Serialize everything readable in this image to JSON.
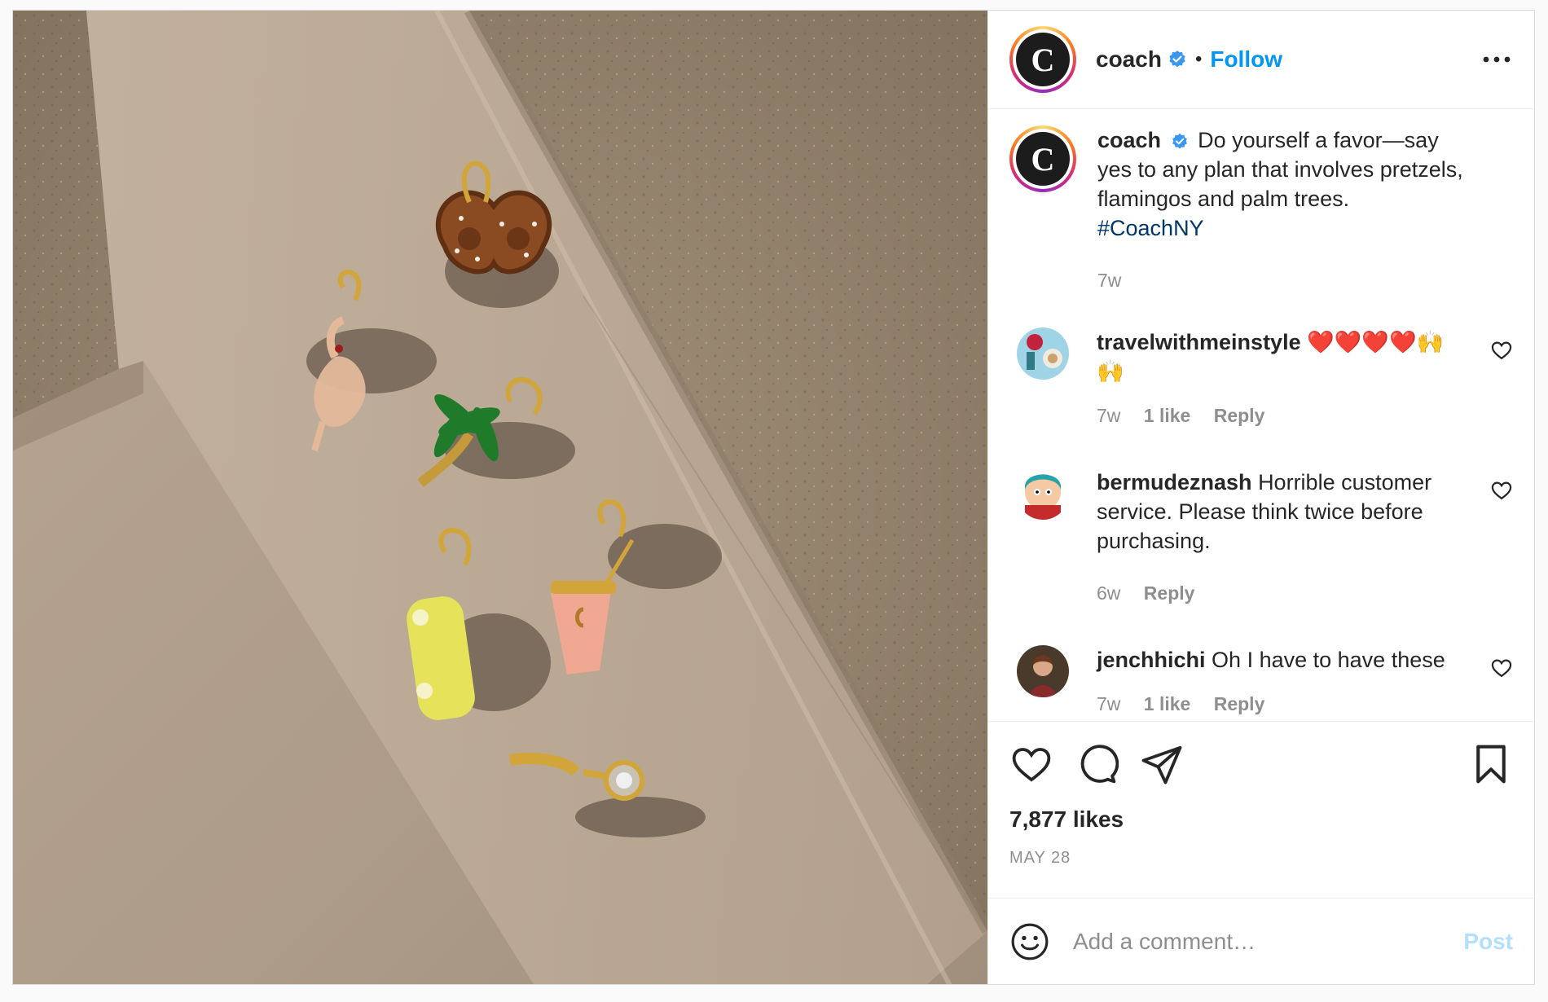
{
  "header": {
    "username": "coach",
    "separator": "•",
    "follow_label": "Follow"
  },
  "caption": {
    "username": "coach",
    "text": "Do yourself a favor—say yes to any plan that involves pretzels, flamingos and palm trees.",
    "hashtag": "#CoachNY",
    "time": "7w"
  },
  "comments": [
    {
      "username": "travelwithmeinstyle",
      "text": "❤️❤️❤️❤️🙌🙌",
      "time": "7w",
      "likes": "1 like",
      "reply_label": "Reply"
    },
    {
      "username": "bermudeznash",
      "text": "Horrible customer service. Please think twice before purchasing.",
      "time": "6w",
      "reply_label": "Reply"
    },
    {
      "username": "jenchhichi",
      "text": "Oh I have to have these",
      "time": "7w",
      "likes": "1 like",
      "reply_label": "Reply"
    }
  ],
  "post": {
    "likes_count": "7,877 likes",
    "date": "MAY 28"
  },
  "composer": {
    "placeholder": "Add a comment…",
    "post_label": "Post"
  },
  "colors": {
    "accent": "#0095f6",
    "post_disabled": "#b2dffc",
    "hashtag": "#00376b",
    "verified": "#3897f0"
  },
  "icons": {
    "more": "more-options-icon",
    "like": "heart-icon",
    "comment": "comment-icon",
    "share": "share-icon",
    "save": "bookmark-icon",
    "emoji": "emoji-icon",
    "verified": "verified-badge-icon"
  }
}
